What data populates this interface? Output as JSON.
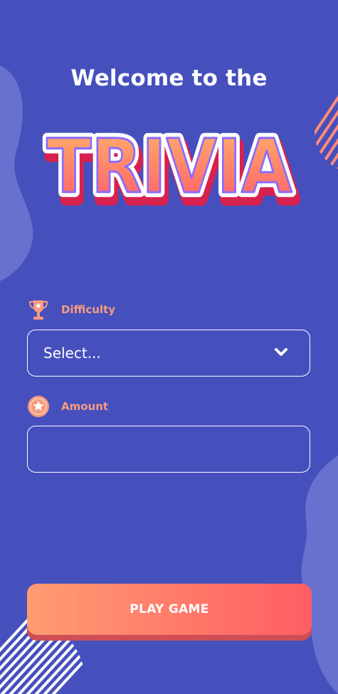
{
  "header": {
    "welcome": "Welcome to the",
    "logo_text": "TRIVIA"
  },
  "form": {
    "difficulty": {
      "label": "Difficulty",
      "icon": "trophy-icon",
      "selected": "Select...",
      "dropdown_icon": "chevron-down-icon"
    },
    "amount": {
      "label": "Amount",
      "icon": "star-badge-icon",
      "value": ""
    }
  },
  "actions": {
    "play_label": "PLAY GAME"
  },
  "colors": {
    "background": "#4650bd",
    "accent": "#f79a7f",
    "button_start": "#ff9c72",
    "button_end": "#ff5d63"
  }
}
